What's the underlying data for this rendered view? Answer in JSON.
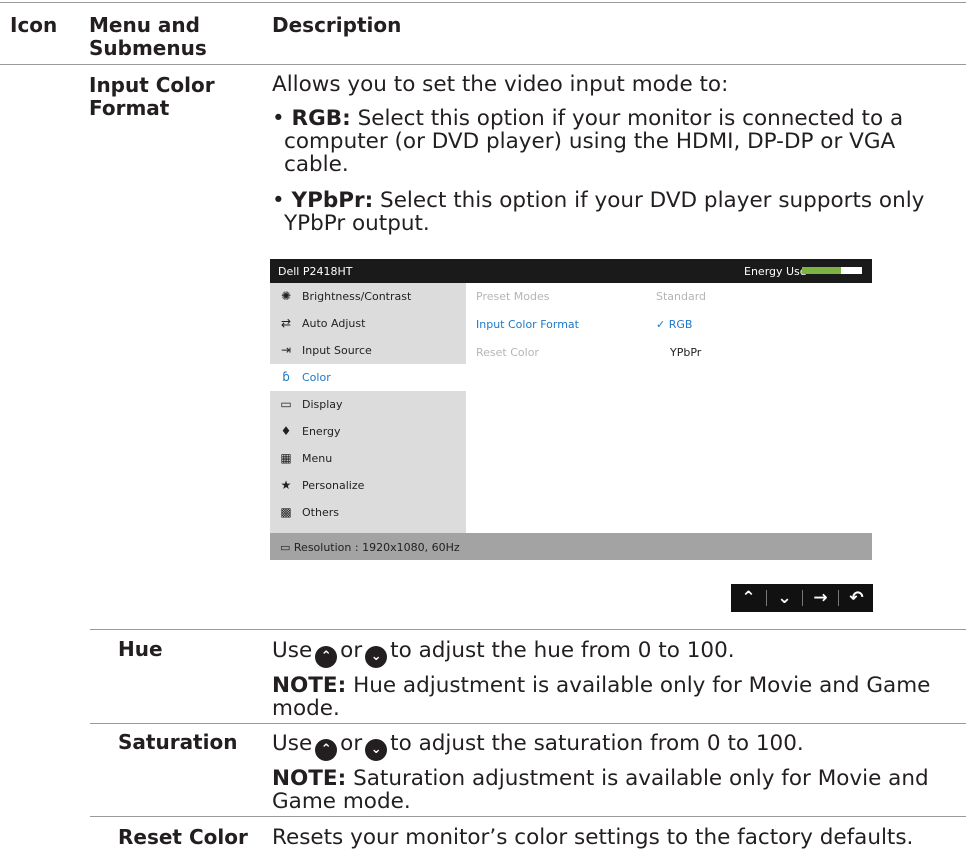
{
  "header": {
    "col1": "Icon",
    "col2_line1": "Menu and",
    "col2_line2": "Submenus",
    "col3": "Description"
  },
  "input_color_format": {
    "label_line1": "Input Color",
    "label_line2": "Format",
    "intro": "Allows you to set the video input mode to:",
    "rgb_term": "RGB:",
    "rgb_line1": " Select this option if your monitor is connected to a",
    "rgb_line2": "computer (or DVD player) using the HDMI, DP-DP or VGA",
    "rgb_line3": "cable.",
    "ypbpr_term": "YPbPr:",
    "ypbpr_line1": " Select this option if your DVD player supports only",
    "ypbpr_line2": "YPbPr output."
  },
  "osd": {
    "model": "Dell P2418HT",
    "energy_label": "Energy Use",
    "energy_level": 0.65,
    "menu": [
      {
        "label": "Brightness/Contrast",
        "icon": "sun-icon"
      },
      {
        "label": "Auto Adjust",
        "icon": "auto-adjust-icon"
      },
      {
        "label": "Input Source",
        "icon": "input-source-icon"
      },
      {
        "label": "Color",
        "icon": "color-icon"
      },
      {
        "label": "Display",
        "icon": "display-icon"
      },
      {
        "label": "Energy",
        "icon": "energy-icon"
      },
      {
        "label": "Menu",
        "icon": "menu-icon"
      },
      {
        "label": "Personalize",
        "icon": "star-icon"
      },
      {
        "label": "Others",
        "icon": "others-icon"
      }
    ],
    "rows": [
      {
        "key": "Preset Modes",
        "value": "Standard"
      },
      {
        "key": "Input Color Format",
        "value": "RGB"
      },
      {
        "key": "Reset Color",
        "value": "YPbPr"
      }
    ],
    "footer": "Resolution : 1920x1080, 60Hz",
    "accent": "#1e78c8"
  },
  "nav_keys": [
    "up-key",
    "down-key",
    "enter-key",
    "back-key"
  ],
  "hue": {
    "label": "Hue",
    "use": "Use",
    "or": "or",
    "rest": "to adjust the hue from 0 to 100.",
    "note_term": "NOTE:",
    "note_line1": " Hue adjustment is available only for Movie and Game",
    "note_line2": "mode."
  },
  "saturation": {
    "label": "Saturation",
    "use": "Use",
    "or": "or",
    "rest": "to adjust the saturation from 0 to 100.",
    "note_term": "NOTE:",
    "note_line1": " Saturation adjustment is available only for Movie and",
    "note_line2": "Game mode."
  },
  "reset_color": {
    "label": "Reset Color",
    "desc": "Resets your monitor’s color settings to the factory defaults."
  }
}
